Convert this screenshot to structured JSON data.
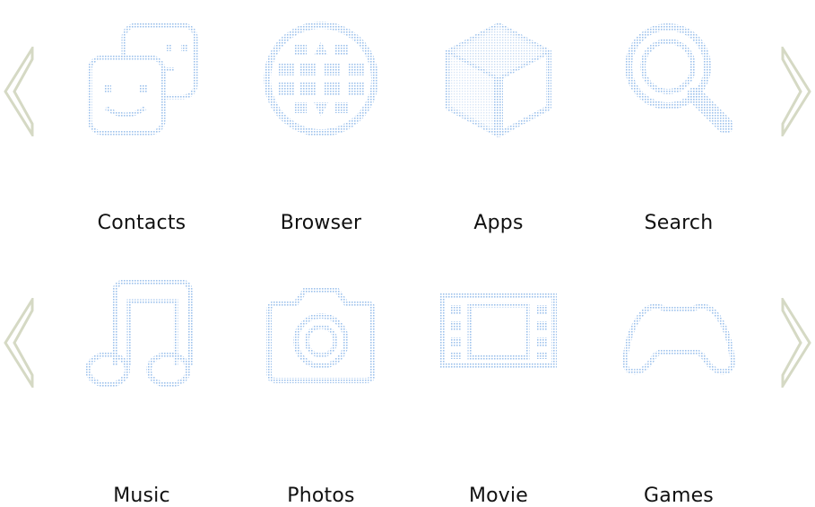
{
  "colors": {
    "icon": "#b8d4f2",
    "arrow": "#d9dcc8",
    "label": "#111111"
  },
  "rows": [
    {
      "tiles": [
        {
          "label": "Contacts",
          "icon": "contacts-icon"
        },
        {
          "label": "Browser",
          "icon": "globe-icon"
        },
        {
          "label": "Apps",
          "icon": "cube-icon"
        },
        {
          "label": "Search",
          "icon": "magnifier-icon"
        }
      ]
    },
    {
      "tiles": [
        {
          "label": "Music",
          "icon": "music-note-icon"
        },
        {
          "label": "Photos",
          "icon": "camera-icon"
        },
        {
          "label": "Movie",
          "icon": "film-icon"
        },
        {
          "label": "Games",
          "icon": "gamepad-icon"
        }
      ]
    }
  ]
}
